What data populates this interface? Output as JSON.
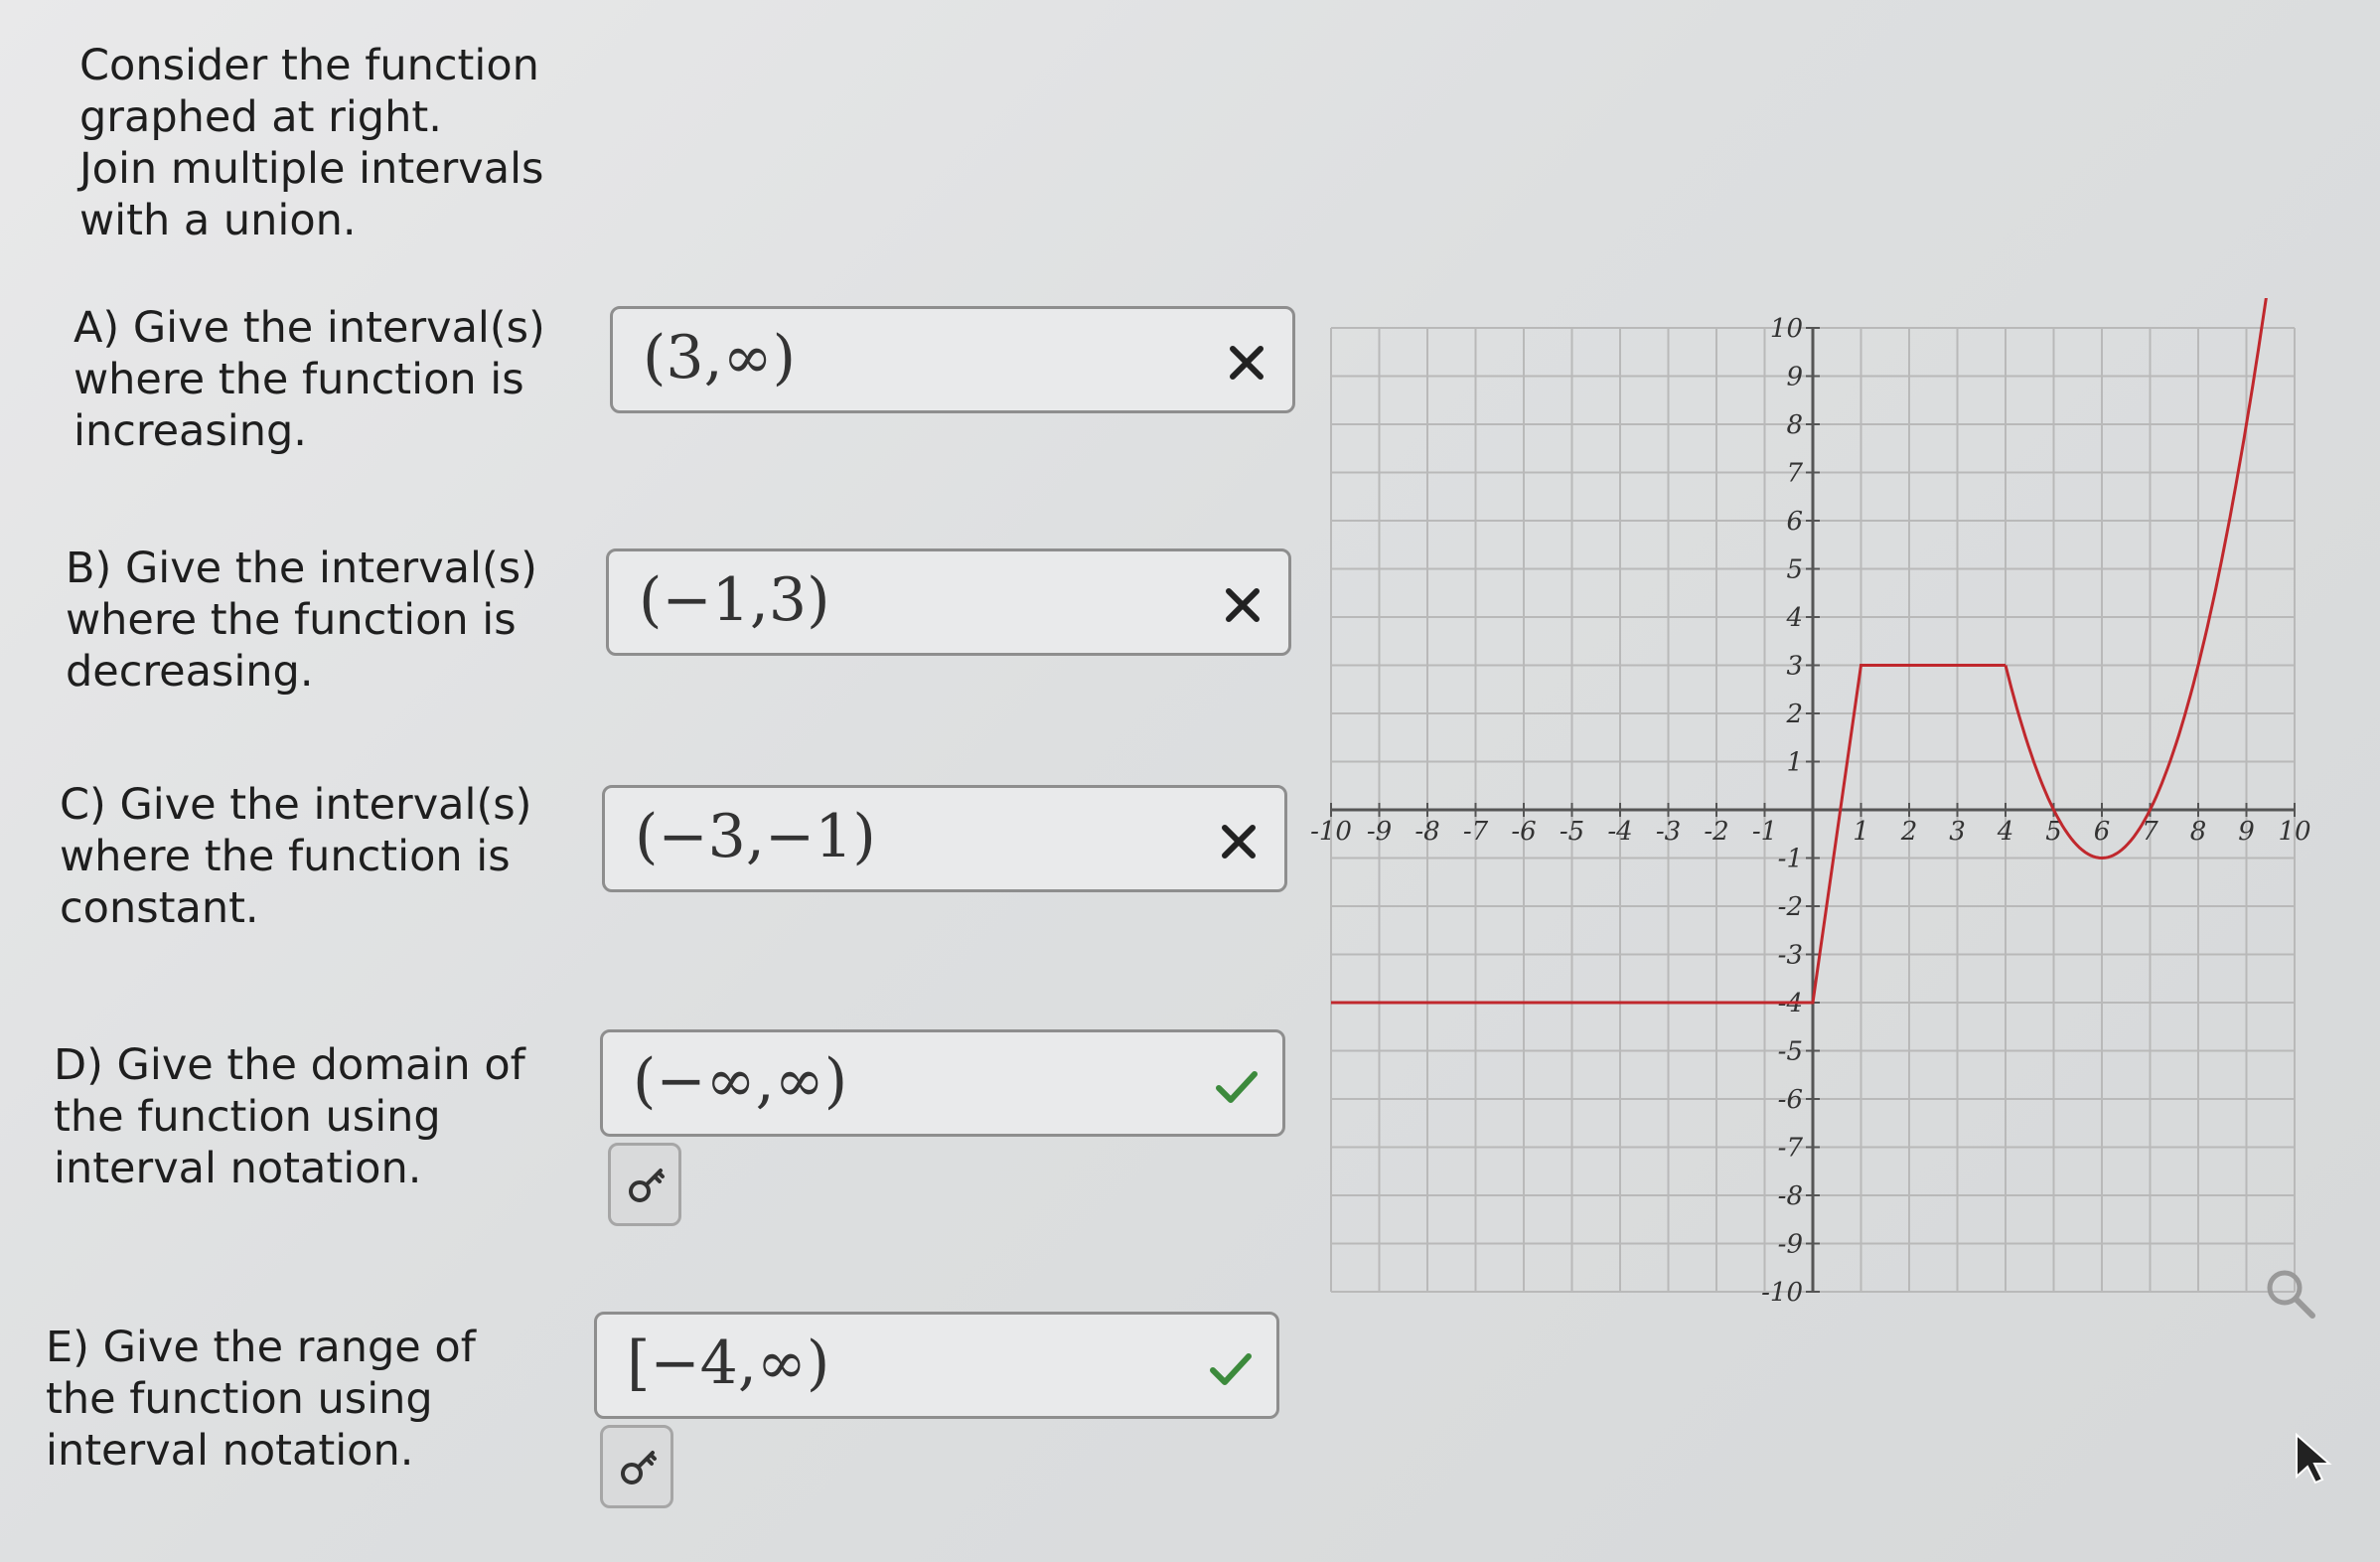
{
  "instructions": [
    "Consider the function",
    "graphed at right.",
    "Join multiple intervals",
    "with a union."
  ],
  "questions": [
    {
      "lines": [
        "A) Give the interval(s)",
        "where the function is",
        "increasing."
      ],
      "answer": "(3,∞)",
      "status": "incorrect",
      "mark": "x-mark-icon",
      "has_key_button": false
    },
    {
      "lines": [
        "B) Give the interval(s)",
        "where the function is",
        "decreasing."
      ],
      "answer": "(−1,3)",
      "status": "incorrect",
      "mark": "x-mark-icon",
      "has_key_button": false
    },
    {
      "lines": [
        "C) Give the interval(s)",
        "where the function is",
        "constant."
      ],
      "answer": "(−3,−1)",
      "status": "incorrect",
      "mark": "x-mark-icon",
      "has_key_button": false
    },
    {
      "lines": [
        "D) Give the domain of",
        "the function using",
        "interval notation."
      ],
      "answer": "(−∞,∞)",
      "status": "correct",
      "mark": "check-mark-icon",
      "has_key_button": true
    },
    {
      "lines": [
        "E) Give the range of",
        "the function using",
        "interval notation."
      ],
      "answer": "[−4,∞)",
      "status": "correct",
      "mark": "check-mark-icon",
      "has_key_button": true
    }
  ],
  "colors": {
    "incorrect": "#222222",
    "correct": "#3c8a3c",
    "curve": "#c0282d",
    "grid": "#b9b9b9",
    "axis": "#555555"
  },
  "icons": {
    "key_button": "key-icon",
    "zoom": "magnifier-icon",
    "cursor": "mouse-pointer-icon"
  },
  "chart_data": {
    "type": "line",
    "x_range": [
      -10,
      10
    ],
    "y_range": [
      -10,
      10
    ],
    "x_ticks": [
      "-10",
      "-9",
      "-8",
      "-7",
      "-6",
      "-5",
      "-4",
      "-3",
      "-2",
      "-1",
      "1",
      "2",
      "3",
      "4",
      "5",
      "6",
      "7",
      "8",
      "9",
      "10"
    ],
    "y_ticks": [
      "10",
      "9",
      "8",
      "7",
      "6",
      "5",
      "4",
      "3",
      "2",
      "1",
      "-1",
      "-2",
      "-3",
      "-4",
      "-5",
      "-6",
      "-7",
      "-8",
      "-9",
      "-10"
    ],
    "grid": true,
    "series": [
      {
        "x": [
          -10,
          0,
          1,
          4
        ],
        "y": [
          -4,
          -4,
          3,
          3
        ]
      },
      {
        "expression": "(x-6)^2-1",
        "x_domain": [
          4,
          9.9
        ]
      }
    ]
  }
}
